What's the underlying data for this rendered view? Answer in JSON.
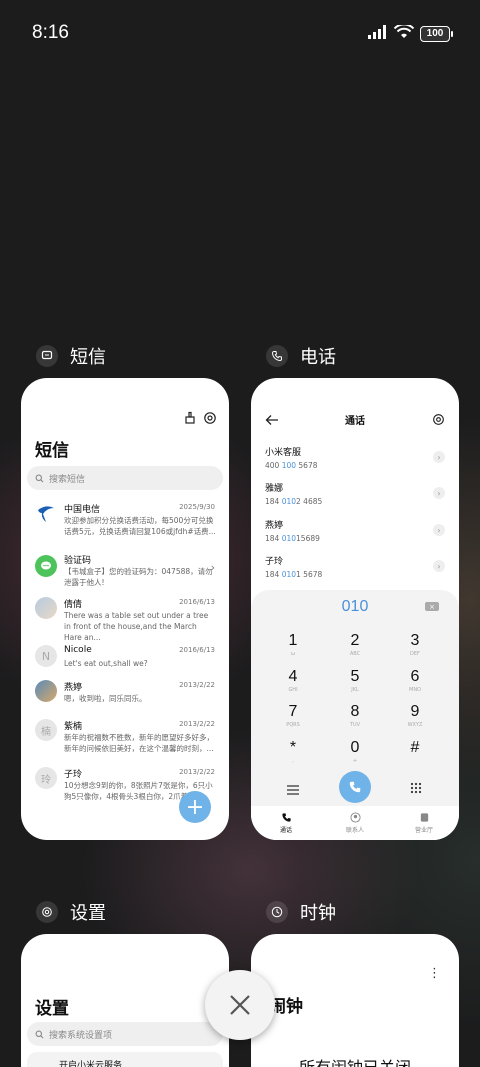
{
  "status_bar": {
    "time": "8:16",
    "battery": "100"
  },
  "apps": {
    "sms": {
      "header_name": "短信",
      "title": "短信",
      "search_placeholder": "搜索短信",
      "messages": [
        {
          "name": "中国电信",
          "date": "2025/9/30",
          "text": "欢迎参加积分兑换话费活动，每500分可兑换话费5元，兑换话费请回复106或jfdh#话费..."
        },
        {
          "name": "验证码",
          "date": "",
          "text": "【韦城盒子】您的验证码为：047588，请勿泄露于他人!"
        },
        {
          "name": "倩倩",
          "date": "2016/6/13",
          "text": "There was a table set out under a tree in front of the house,and the March Hare an..."
        },
        {
          "name": "Nicole",
          "date": "2016/6/13",
          "text": "Let's eat out,shall we?"
        },
        {
          "name": "燕婷",
          "date": "2013/2/22",
          "text": "嗯，收到啦，同乐同乐。"
        },
        {
          "name": "紫楠",
          "date": "2013/2/22",
          "text": "新年的祝福数不胜数，新年的愿望好多好多，新年的问候依旧美好，在这个温馨的时刻，..."
        },
        {
          "name": "子玲",
          "date": "2013/2/22",
          "text": "10分想念9到的你，8张照片7张是你，6只小狗5只像你，4根骨头3根白你，2爪着..."
        }
      ],
      "avatar_letters": {
        "nicole": "N",
        "zinan": "楠",
        "ziling": "玲"
      },
      "fab_label": "+"
    },
    "phone": {
      "header_name": "电话",
      "title": "通话",
      "contacts": [
        {
          "name": "小米客服",
          "pre": "400 ",
          "hl": "100",
          "post": " 5678"
        },
        {
          "name": "雅娜",
          "pre": "184 ",
          "hl": "010",
          "post": "2 4685"
        },
        {
          "name": "燕婷",
          "pre": "184 ",
          "hl": "010",
          "post": "15689"
        },
        {
          "name": "子玲",
          "pre": "184 ",
          "hl": "010",
          "post": "1 5678"
        }
      ],
      "dial_number": "010",
      "keys": [
        {
          "d": "1",
          "l": "ω"
        },
        {
          "d": "2",
          "l": "ABC"
        },
        {
          "d": "3",
          "l": "DEF"
        },
        {
          "d": "4",
          "l": "GHI"
        },
        {
          "d": "5",
          "l": "JKL"
        },
        {
          "d": "6",
          "l": "MNO"
        },
        {
          "d": "7",
          "l": "PQRS"
        },
        {
          "d": "8",
          "l": "TUV"
        },
        {
          "d": "9",
          "l": "WXYZ"
        },
        {
          "d": "*",
          "l": ","
        },
        {
          "d": "0",
          "l": "+"
        },
        {
          "d": "#",
          "l": ""
        }
      ],
      "tabs": [
        "通话",
        "联系人",
        "营业厅"
      ]
    },
    "settings": {
      "header_name": "设置",
      "title": "设置",
      "search_placeholder": "搜索系统设置项",
      "first_item": "开启小米云服务"
    },
    "clock": {
      "header_name": "时钟",
      "title": "闹钟",
      "message": "所有闹钟已关闭"
    }
  },
  "colors": {
    "accent": "#6fb3e8",
    "highlight": "#4a90d9",
    "background": "#1c1c1d"
  }
}
